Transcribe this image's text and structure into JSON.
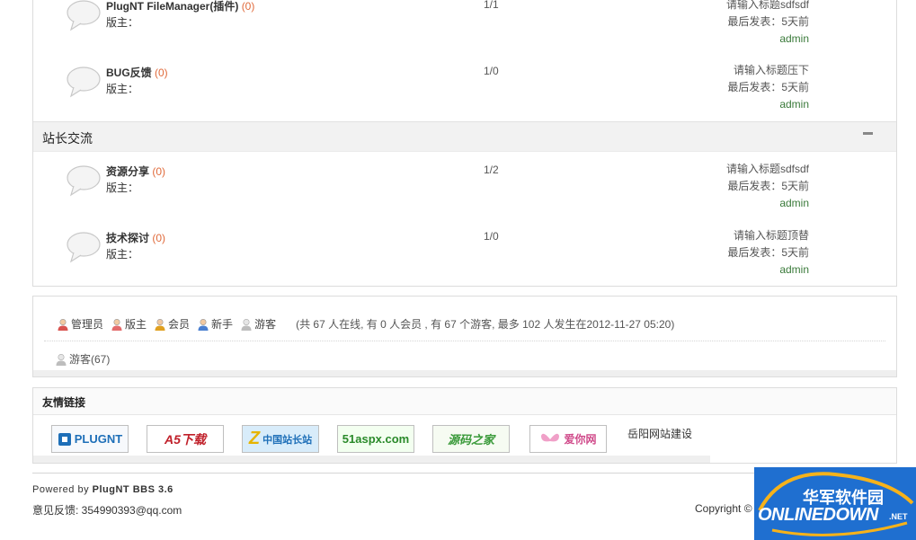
{
  "forums": [
    {
      "name": "PlugNT FileManager(插件)",
      "count": "(0)",
      "moderator": "版主：",
      "stat": "1/1",
      "last_title": "请输入标题sdfsdf",
      "last_time": "最后发表：5天前",
      "last_user": "admin"
    },
    {
      "name": "BUG反馈",
      "count": "(0)",
      "moderator": "版主：",
      "stat": "1/0",
      "last_title": "请输入标题压下",
      "last_time": "最后发表：5天前",
      "last_user": "admin"
    }
  ],
  "section": {
    "title": "站长交流"
  },
  "section_forums": [
    {
      "name": "资源分享",
      "count": "(0)",
      "moderator": "版主：",
      "stat": "1/2",
      "last_title": "请输入标题sdfsdf",
      "last_time": "最后发表：5天前",
      "last_user": "admin"
    },
    {
      "name": "技术探讨",
      "count": "(0)",
      "moderator": "版主：",
      "stat": "1/0",
      "last_title": "请输入标题顶替",
      "last_time": "最后发表：5天前",
      "last_user": "admin"
    }
  ],
  "online": {
    "legend": [
      {
        "label": "管理员",
        "color": "#d9534f",
        "icon": "admin-user-icon"
      },
      {
        "label": "版主",
        "color": "#e36b6b",
        "icon": "moderator-user-icon"
      },
      {
        "label": "会员",
        "color": "#e0a020",
        "icon": "member-user-icon"
      },
      {
        "label": "新手",
        "color": "#4a7fd0",
        "icon": "newbie-user-icon"
      },
      {
        "label": "游客",
        "color": "#bdbdbd",
        "icon": "guest-user-icon"
      }
    ],
    "stats": "(共 67 人在线, 有 0 人会员 , 有 67 个游客, 最多 102 人发生在2012-11-27 05:20)",
    "guest_line": "游客(67)"
  },
  "links": {
    "title": "友情链接",
    "logos": [
      {
        "text": "PLUGNT",
        "color": "#1e6fb8"
      },
      {
        "text": "A5下载",
        "color": "#c0202a"
      },
      {
        "text": "中国站长站",
        "color": "#1e6fb8"
      },
      {
        "text": "51aspx.com",
        "color": "#2a8a2a"
      },
      {
        "text": "源码之家",
        "color": "#3a9a3a"
      },
      {
        "text": "爱你网",
        "color": "#d04a8a"
      }
    ],
    "text_link": "岳阳网站建设"
  },
  "footer": {
    "powered_prefix": "Powered by ",
    "powered_brand": "PlugNT BBS 3.6",
    "feedback": "意见反馈: 354990393@qq.com",
    "copyright": "Copyright ©"
  },
  "watermark": {
    "cn": "华军软件园",
    "en": "ONLINEDOWN",
    "net": ".NET"
  }
}
